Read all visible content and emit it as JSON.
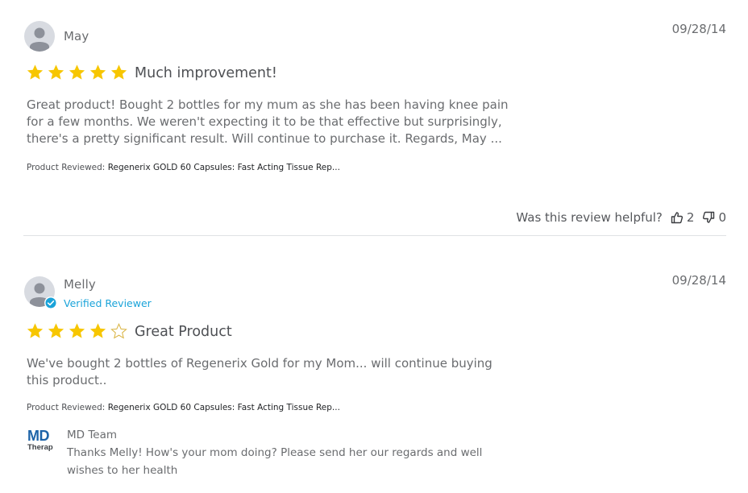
{
  "reviews": [
    {
      "name": "May",
      "date": "09/28/14",
      "rating": 5,
      "title": "Much improvement!",
      "body": "Great product! Bought 2 bottles for my mum as she has been having knee pain for a few months. We weren't expecting it to be that effective but surprisingly, there's a pretty significant result. Will continue to purchase it. Regards, May ...",
      "product_label": "Product Reviewed:",
      "product_name": "Regenerix GOLD 60 Capsules: Fast Acting Tissue Rep...",
      "helpful_question": "Was this review helpful?",
      "upvotes": "2",
      "downvotes": "0"
    },
    {
      "name": "Melly",
      "verified": "Verified Reviewer",
      "date": "09/28/14",
      "rating": 4,
      "title": "Great Product",
      "body": "We've bought 2 bottles of Regenerix Gold for my Mom... will continue buying this product..",
      "product_label": "Product Reviewed:",
      "product_name": "Regenerix GOLD 60 Capsules: Fast Acting Tissue Rep...",
      "reply": {
        "logo_main": "MD",
        "logo_sub": "Therap",
        "name": "MD Team",
        "text": "Thanks Melly! How's your mom doing? Please send her our regards and well wishes to her health"
      }
    }
  ],
  "colors": {
    "star_filled": "#f7c600",
    "star_empty": "#d9b340",
    "verified": "#1aa3d9",
    "logo_blue": "#1d63a8"
  }
}
